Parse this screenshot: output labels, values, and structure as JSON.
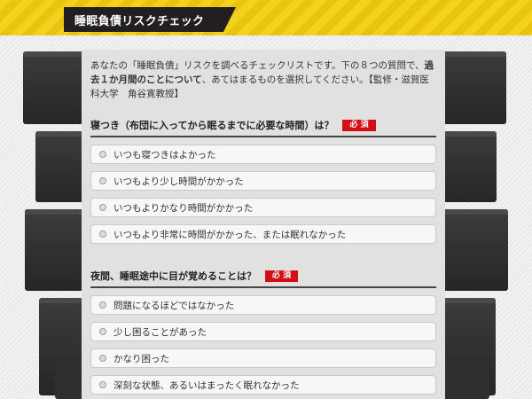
{
  "header": {
    "title": "睡眠負債リスクチェック"
  },
  "intro": {
    "part1": "あなたの「睡眠負債」リスクを調べるチェックリストです。下の８つの質問で、",
    "highlight": "過去１か月間のことについて",
    "part2": "、あてはまるものを選択してください。【監修・滋賀医科大学　角谷寛教授】"
  },
  "questions": [
    {
      "title": "寝つき（布団に入ってから眠るまでに必要な時間）は？",
      "badge": "必 須",
      "options": [
        "いつも寝つきはよかった",
        "いつもより少し時間がかかった",
        "いつもよりかなり時間がかかった",
        "いつもより非常に時間がかかった、または眠れなかった"
      ]
    },
    {
      "title": "夜間、睡眠途中に目が覚めることは？",
      "badge": "必 須",
      "options": [
        "問題になるほどではなかった",
        "少し困ることがあった",
        "かなり困った",
        "深刻な状態、あるいはまったく眠れなかった"
      ]
    }
  ],
  "colors": {
    "accent_yellow": "#f2d21e",
    "title_bg": "#231f20",
    "required_red": "#d10f15",
    "panel_bg": "#e1e1e1"
  }
}
